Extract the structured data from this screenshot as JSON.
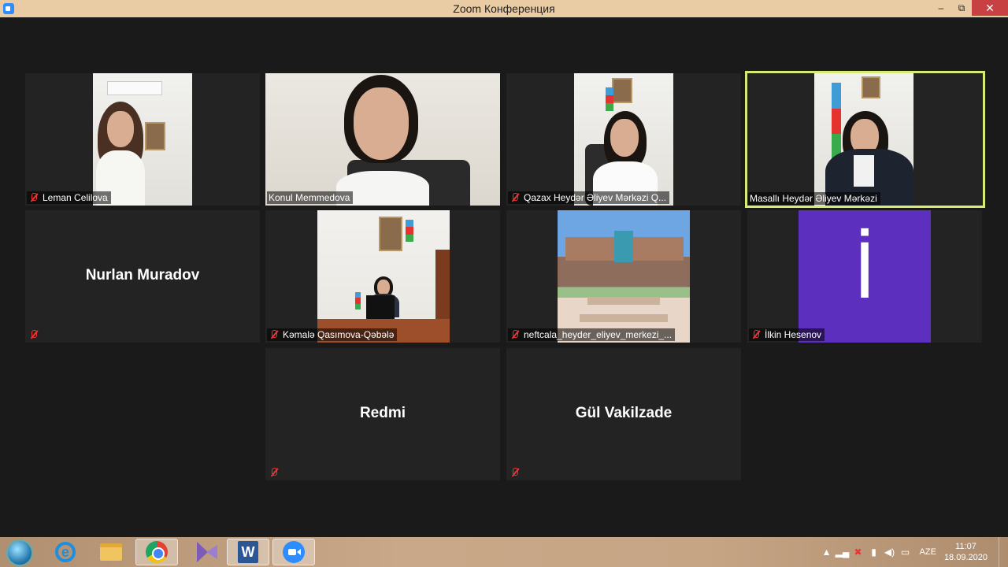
{
  "window": {
    "title": "Zoom Конференция",
    "min_label": "‒",
    "max_label": "⧉",
    "close_label": "✕"
  },
  "participants": [
    {
      "name": "Leman Celilova",
      "muted": true,
      "video": true
    },
    {
      "name": "Konul Memmedova",
      "muted": false,
      "video": true
    },
    {
      "name": "Qazax Heydər Əliyev Mərkəzi Q...",
      "muted": true,
      "video": true
    },
    {
      "name": "Masallı Heydər Əliyev Mərkəzi",
      "muted": false,
      "video": true,
      "active_speaker": true
    },
    {
      "name": "Nurlan Muradov",
      "muted": true,
      "video": false
    },
    {
      "name": "Kəmalə Qasımova-Qəbələ",
      "muted": true,
      "video": true
    },
    {
      "name": "neftcala_heyder_eliyev_merkezi_...",
      "muted": true,
      "video": true
    },
    {
      "name": "İlkin Hesenov",
      "muted": true,
      "video": false,
      "avatar_letter": "İ",
      "avatar_color": "#5c2fbf"
    },
    {
      "name": "Redmi",
      "muted": true,
      "video": false
    },
    {
      "name": "Gül Vakilzade",
      "muted": true,
      "video": false
    }
  ],
  "taskbar": {
    "apps": [
      "start-orb-icon",
      "internet-explorer-icon",
      "file-explorer-icon",
      "chrome-icon",
      "visual-studio-icon",
      "word-icon",
      "zoom-icon"
    ],
    "language": "AZE",
    "time": "11:07",
    "date": "18.09.2020"
  },
  "colors": {
    "titlebar": "#e9cba4",
    "close_button": "#c74143",
    "active_speaker_border": "#d6ea74",
    "stage_background": "#1a1a1a",
    "tile_background": "#232323"
  }
}
